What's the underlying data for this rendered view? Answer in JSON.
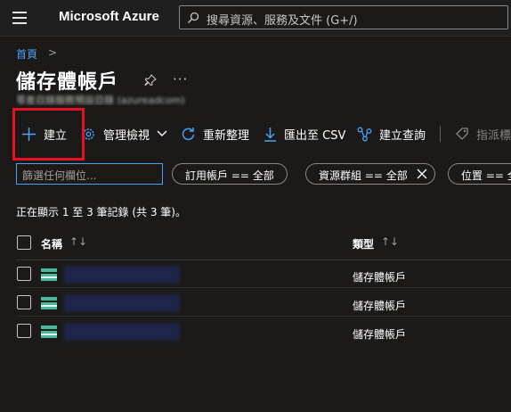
{
  "topbar": {
    "brand": "Microsoft Azure",
    "search_placeholder": "搜尋資源、服務及文件 (G+/)"
  },
  "breadcrumb": {
    "home": "首頁",
    "separator": ">"
  },
  "page": {
    "title": "儲存體帳戶",
    "more": "···",
    "subtitle": "零差目錄服務預設目錄 (azureadcom)"
  },
  "toolbar": {
    "create": "建立",
    "manage_view": "管理檢視",
    "refresh": "重新整理",
    "export_csv": "匯出至 CSV",
    "open_query": "建立查詢",
    "assign_tags": "指派標"
  },
  "filters": {
    "input_placeholder": "篩選任何欄位...",
    "subscription": "訂用帳戶 == 全部",
    "resource_group": "資源群組 == 全部",
    "location": "位置 == 全"
  },
  "records_text": "正在顯示 1 至 3 筆記錄 (共 3 筆)。",
  "table": {
    "col_name": "名稱",
    "col_type": "類型",
    "sort_glyph": "↑↓",
    "rows": [
      {
        "type": "儲存體帳戶"
      },
      {
        "type": "儲存體帳戶"
      },
      {
        "type": "儲存體帳戶"
      }
    ]
  },
  "colors": {
    "background": "#1b1a19",
    "accent_link": "#4ba1f5",
    "highlight": "#e81123",
    "storage_icon": "#46b99c"
  }
}
